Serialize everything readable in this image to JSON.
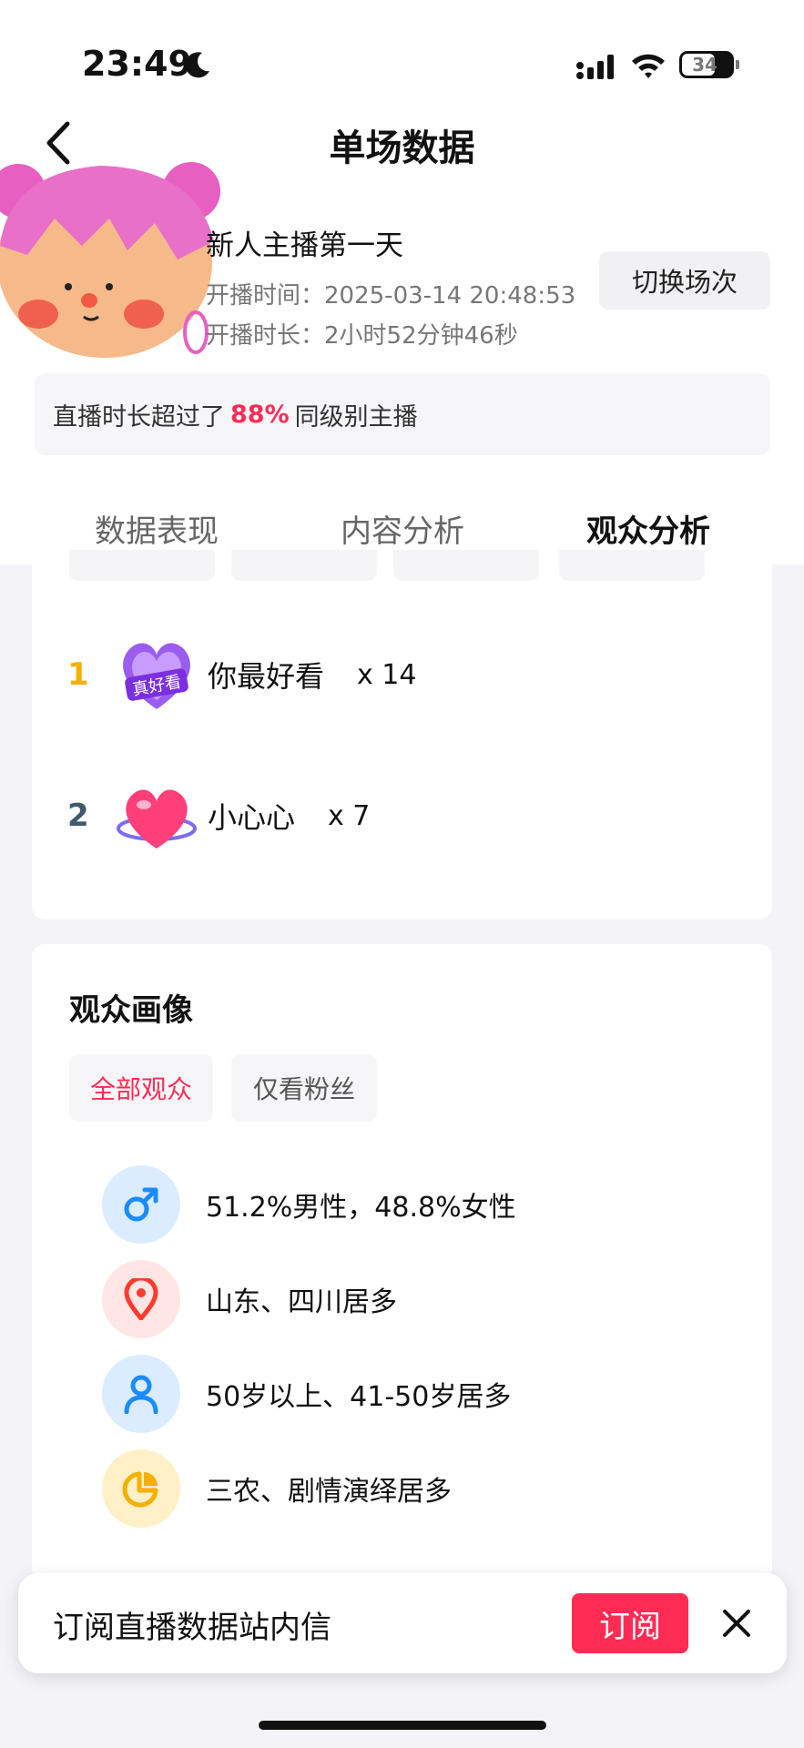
{
  "status_bar": {
    "time": "23:49",
    "battery": "34"
  },
  "header": {
    "title": "单场数据"
  },
  "session": {
    "title": "新人主播第一天",
    "start_label": "开播时间：",
    "start_time": "2025-03-14 20:48:53",
    "duration_label": "开播时长：",
    "duration": "2小时52分钟46秒",
    "switch_button": "切换场次",
    "compare_prefix": "直播时长超过了",
    "compare_pct": "88%",
    "compare_suffix": "同级别主播"
  },
  "tabs": [
    {
      "label": "数据表现",
      "active": false
    },
    {
      "label": "内容分析",
      "active": false
    },
    {
      "label": "观众分析",
      "active": true
    }
  ],
  "gifts": [
    {
      "rank": "1",
      "name": "你最好看",
      "count": "x 14",
      "icon": "purple-heart-gift-icon",
      "badge": "真好看",
      "rank_color": "#f5b000"
    },
    {
      "rank": "2",
      "name": "小心心",
      "count": "x 7",
      "icon": "pink-heart-gift-icon",
      "rank_color": "#3f5a6b"
    }
  ],
  "audience": {
    "title": "观众画像",
    "filters": [
      {
        "label": "全部观众",
        "active": true
      },
      {
        "label": "仅看粉丝",
        "active": false
      }
    ],
    "stats": [
      {
        "icon": "male-gender-icon",
        "text": "51.2%男性，48.8%女性",
        "color": "#1a8cff"
      },
      {
        "icon": "location-pin-icon",
        "text": "山东、四川居多",
        "color": "#ff3b30"
      },
      {
        "icon": "person-icon",
        "text": "50岁以上、41-50岁居多",
        "color": "#1a8cff"
      },
      {
        "icon": "pie-chart-icon",
        "text": "三农、剧情演绎居多",
        "color": "#f5b000"
      }
    ]
  },
  "subscribe": {
    "text": "订阅直播数据站内信",
    "button": "订阅"
  },
  "colors": {
    "accent": "#fe2c55",
    "background": "#f3f3f8"
  }
}
